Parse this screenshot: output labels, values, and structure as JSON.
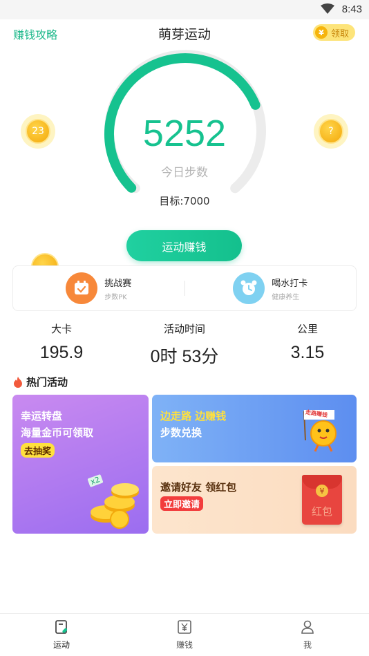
{
  "status_bar": {
    "time": "8:43"
  },
  "header": {
    "left_link": "赚钱攻略",
    "title": "萌芽运动",
    "claim_coin_symbol": "¥",
    "claim_label": "领取"
  },
  "gauge": {
    "steps": "5252",
    "label": "今日步数",
    "target": "目标:7000",
    "progress": 0.75,
    "colors": {
      "progress": "#16c28f",
      "track": "#ececec"
    }
  },
  "floating_coins": {
    "left": "23",
    "right": "?"
  },
  "earn_button": "运动赚钱",
  "features": [
    {
      "title": "挑战赛",
      "subtitle": "步数PK",
      "icon": "calendar-check-icon",
      "color": "#f7883a"
    },
    {
      "title": "喝水打卡",
      "subtitle": "健康养生",
      "icon": "alarm-clock-icon",
      "color": "#7fd1f1"
    }
  ],
  "stats": [
    {
      "label": "大卡",
      "value": "195.9"
    },
    {
      "label": "活动时间",
      "value": "0时 53分"
    },
    {
      "label": "公里",
      "value": "3.15"
    }
  ],
  "hot": {
    "title": "热门活动",
    "lottery": {
      "line1": "幸运转盘",
      "line2": "海量金币可领取",
      "tag": "去抽奖",
      "badge": "x2"
    },
    "walk": {
      "line1": "边走路 边赚钱",
      "line2": "步数兑换",
      "flag": "走路赚钱"
    },
    "invite": {
      "line1": "邀请好友 领红包",
      "tag": "立即邀请",
      "envelope_symbol": "¥",
      "envelope_text": "红包"
    }
  },
  "tabs": [
    {
      "label": "运动",
      "icon": "sport-icon",
      "active": true
    },
    {
      "label": "赚钱",
      "icon": "yen-doc-icon",
      "active": false
    },
    {
      "label": "我",
      "icon": "person-icon",
      "active": false
    }
  ],
  "accent_color": "#16c28f"
}
